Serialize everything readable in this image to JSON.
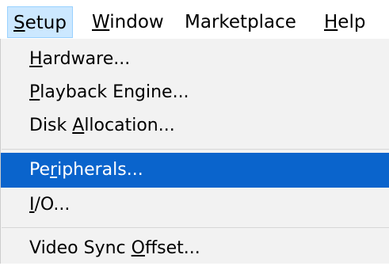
{
  "menubar": {
    "items": [
      {
        "pre": "",
        "acc": "S",
        "post": "etup"
      },
      {
        "pre": "",
        "acc": "W",
        "post": "indow"
      },
      {
        "pre": "Marketplace",
        "acc": "",
        "post": ""
      },
      {
        "pre": "",
        "acc": "H",
        "post": "elp"
      }
    ]
  },
  "menu": {
    "items": [
      {
        "pre": "",
        "acc": "H",
        "post": "ardware..."
      },
      {
        "pre": "",
        "acc": "P",
        "post": "layback Engine..."
      },
      {
        "pre": "Disk ",
        "acc": "A",
        "post": "llocation..."
      },
      {
        "pre": "Pe",
        "acc": "r",
        "post": "ipherals..."
      },
      {
        "pre": "",
        "acc": "I",
        "post": "/O..."
      },
      {
        "pre": "Video Sync ",
        "acc": "O",
        "post": "ffset..."
      }
    ],
    "highlight_color": "#0a64cc"
  }
}
